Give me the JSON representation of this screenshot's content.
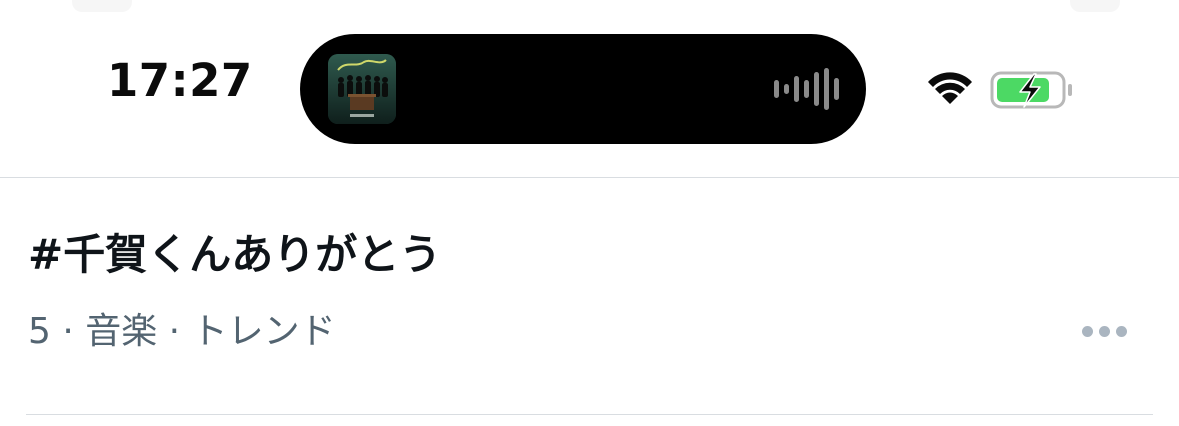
{
  "status_bar": {
    "time": "17:27",
    "wifi_icon": "wifi-icon",
    "battery_icon": "battery-charging-icon",
    "battery_color": "#4cd964"
  },
  "dynamic_island": {
    "album_art_icon": "album-art-thumbnail",
    "waveform_icon": "audio-waveform-icon"
  },
  "trend": {
    "title": "#千賀くんありがとう",
    "meta": "5 · 音楽 · トレンド",
    "more_icon": "more-options-icon"
  },
  "colors": {
    "text_primary": "#0f1419",
    "text_secondary": "#536471",
    "divider": "#d9dde1",
    "more_dots": "#aab5c0"
  }
}
